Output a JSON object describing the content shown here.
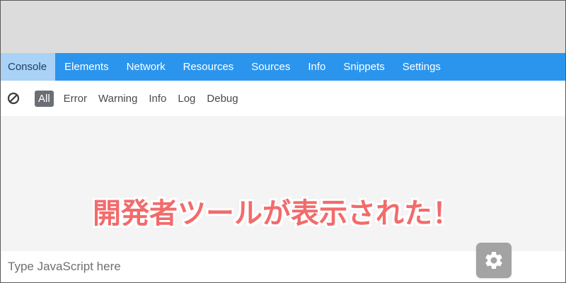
{
  "tabs": [
    {
      "label": "Console",
      "active": true
    },
    {
      "label": "Elements",
      "active": false
    },
    {
      "label": "Network",
      "active": false
    },
    {
      "label": "Resources",
      "active": false
    },
    {
      "label": "Sources",
      "active": false
    },
    {
      "label": "Info",
      "active": false
    },
    {
      "label": "Snippets",
      "active": false
    },
    {
      "label": "Settings",
      "active": false
    }
  ],
  "filters": [
    {
      "label": "All",
      "active": true
    },
    {
      "label": "Error",
      "active": false
    },
    {
      "label": "Warning",
      "active": false
    },
    {
      "label": "Info",
      "active": false
    },
    {
      "label": "Log",
      "active": false
    },
    {
      "label": "Debug",
      "active": false
    }
  ],
  "toolbar": {
    "clear_icon": "clear-console-icon"
  },
  "console": {
    "input_placeholder": "Type JavaScript here",
    "settings_icon": "gear-icon"
  },
  "annotation": {
    "text": "開発者ツールが表示された！"
  },
  "colors": {
    "tabbar": "#2b95ee",
    "tab_active": "#a9d2f6",
    "filter_active": "#6b6f75",
    "annotation": "#f26b6b",
    "gear_button": "#a3a3a3"
  }
}
